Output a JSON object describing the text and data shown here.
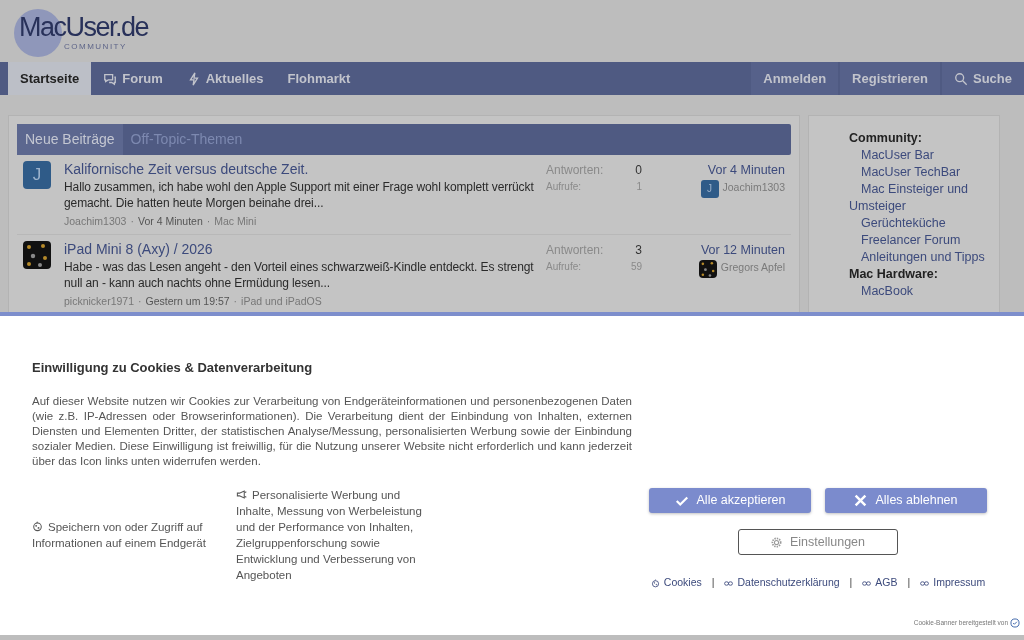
{
  "header": {
    "logo": {
      "text": "MacUser.de",
      "subtitle": "COMMUNITY"
    }
  },
  "nav": {
    "items": [
      {
        "label": "Startseite",
        "kind": "home",
        "selected": true
      },
      {
        "label": "Forum",
        "kind": "forum",
        "selected": false
      },
      {
        "label": "Aktuelles",
        "kind": "news",
        "selected": false
      },
      {
        "label": "Flohmarkt",
        "kind": "market",
        "selected": false
      }
    ],
    "right": [
      {
        "label": "Anmelden",
        "kind": "login"
      },
      {
        "label": "Registrieren",
        "kind": "register"
      },
      {
        "label": "Suche",
        "kind": "search"
      }
    ]
  },
  "tabs": [
    {
      "label": "Neue Beiträge",
      "selected": true
    },
    {
      "label": "Off-Topic-Themen",
      "selected": false
    }
  ],
  "threads": [
    {
      "avatar": {
        "kind": "letter",
        "letter": "J"
      },
      "title": "Kalifornische Zeit versus deutsche Zeit.",
      "excerpt": "Hallo zusammen, ich habe wohl den Apple Support mit einer Frage wohl komplett verrückt gemacht. Die hatten heute Morgen beinahe drei...",
      "author": "Joachim1303",
      "separator": "·",
      "time": "Vor 4 Minuten",
      "forum": "Mac Mini",
      "replies_label": "Antworten:",
      "replies": "0",
      "views_label": "Aufrufe:",
      "views": "1",
      "last_time": "Vor 4 Minuten",
      "last_avatar": {
        "kind": "letter",
        "letter": "J"
      },
      "last_user": "Joachim1303"
    },
    {
      "title": "iPad Mini 8 (Axy) / 2026",
      "excerpt": "Habe - was das Lesen angeht - den Vorteil eines schwarzweiß-Kindle entdeckt. Es strengt null an - kann auch nachts ohne Ermüdung lesen...",
      "author": "picknicker1971",
      "separator": "·",
      "time": "Gestern um 19:57",
      "forum": "iPad und iPadOS",
      "replies_label": "Antworten:",
      "replies": "3",
      "views_label": "Aufrufe:",
      "views": "59",
      "last_time": "Vor 12 Minuten",
      "last_user": "Gregors Apfel"
    }
  ],
  "sidebar": {
    "sections": [
      {
        "heading": "Community:",
        "items": [
          "MacUser Bar",
          "MacUser TechBar",
          "Mac Einsteiger und Umsteiger",
          "Gerüchteküche",
          "Freelancer Forum",
          "Anleitungen und Tipps"
        ]
      },
      {
        "heading": "Mac Hardware:",
        "items": [
          "MacBook"
        ]
      }
    ]
  },
  "cookie_banner": {
    "title": "Einwilligung zu Cookies & Datenverarbeitung",
    "text": "Auf dieser Website nutzen wir Cookies zur Verarbeitung von Endgeräteinformationen und personenbezogenen Daten (wie z.B. IP-Adressen oder Browserinformationen). Die Verarbeitung dient der Einbindung von Inhalten, externen Diensten und Elementen Dritter, der statistischen Analyse/Messung, personalisierten Werbung sowie der Einbindung sozialer Medien. Diese Einwilligung ist freiwillig, für die Nutzung unserer Website nicht erforderlich und kann jederzeit über das Icon links unten widerrufen werden.",
    "purposes": [
      {
        "kind": "storage",
        "text": "Speichern von oder Zugriff auf Informationen auf einem Endgerät"
      },
      {
        "kind": "ads",
        "text": "Personalisierte Werbung und Inhalte, Messung von Werbeleistung und der Performance von Inhalten, Zielgruppenforschung sowie Entwicklung und Verbesserung von Angeboten"
      }
    ],
    "buttons": [
      {
        "kind": "accept",
        "label": "Alle akzeptieren"
      },
      {
        "kind": "reject",
        "label": "Alles ablehnen"
      },
      {
        "kind": "settings",
        "label": "Einstellungen"
      }
    ],
    "links": [
      {
        "kind": "cookies",
        "label": "Cookies"
      },
      {
        "kind": "page",
        "label": "Datenschutzerklärung"
      },
      {
        "kind": "page",
        "label": "AGB"
      },
      {
        "kind": "page",
        "label": "Impressum"
      }
    ],
    "separator": "|",
    "credit": "Cookie-Banner bereitgestellt von"
  }
}
